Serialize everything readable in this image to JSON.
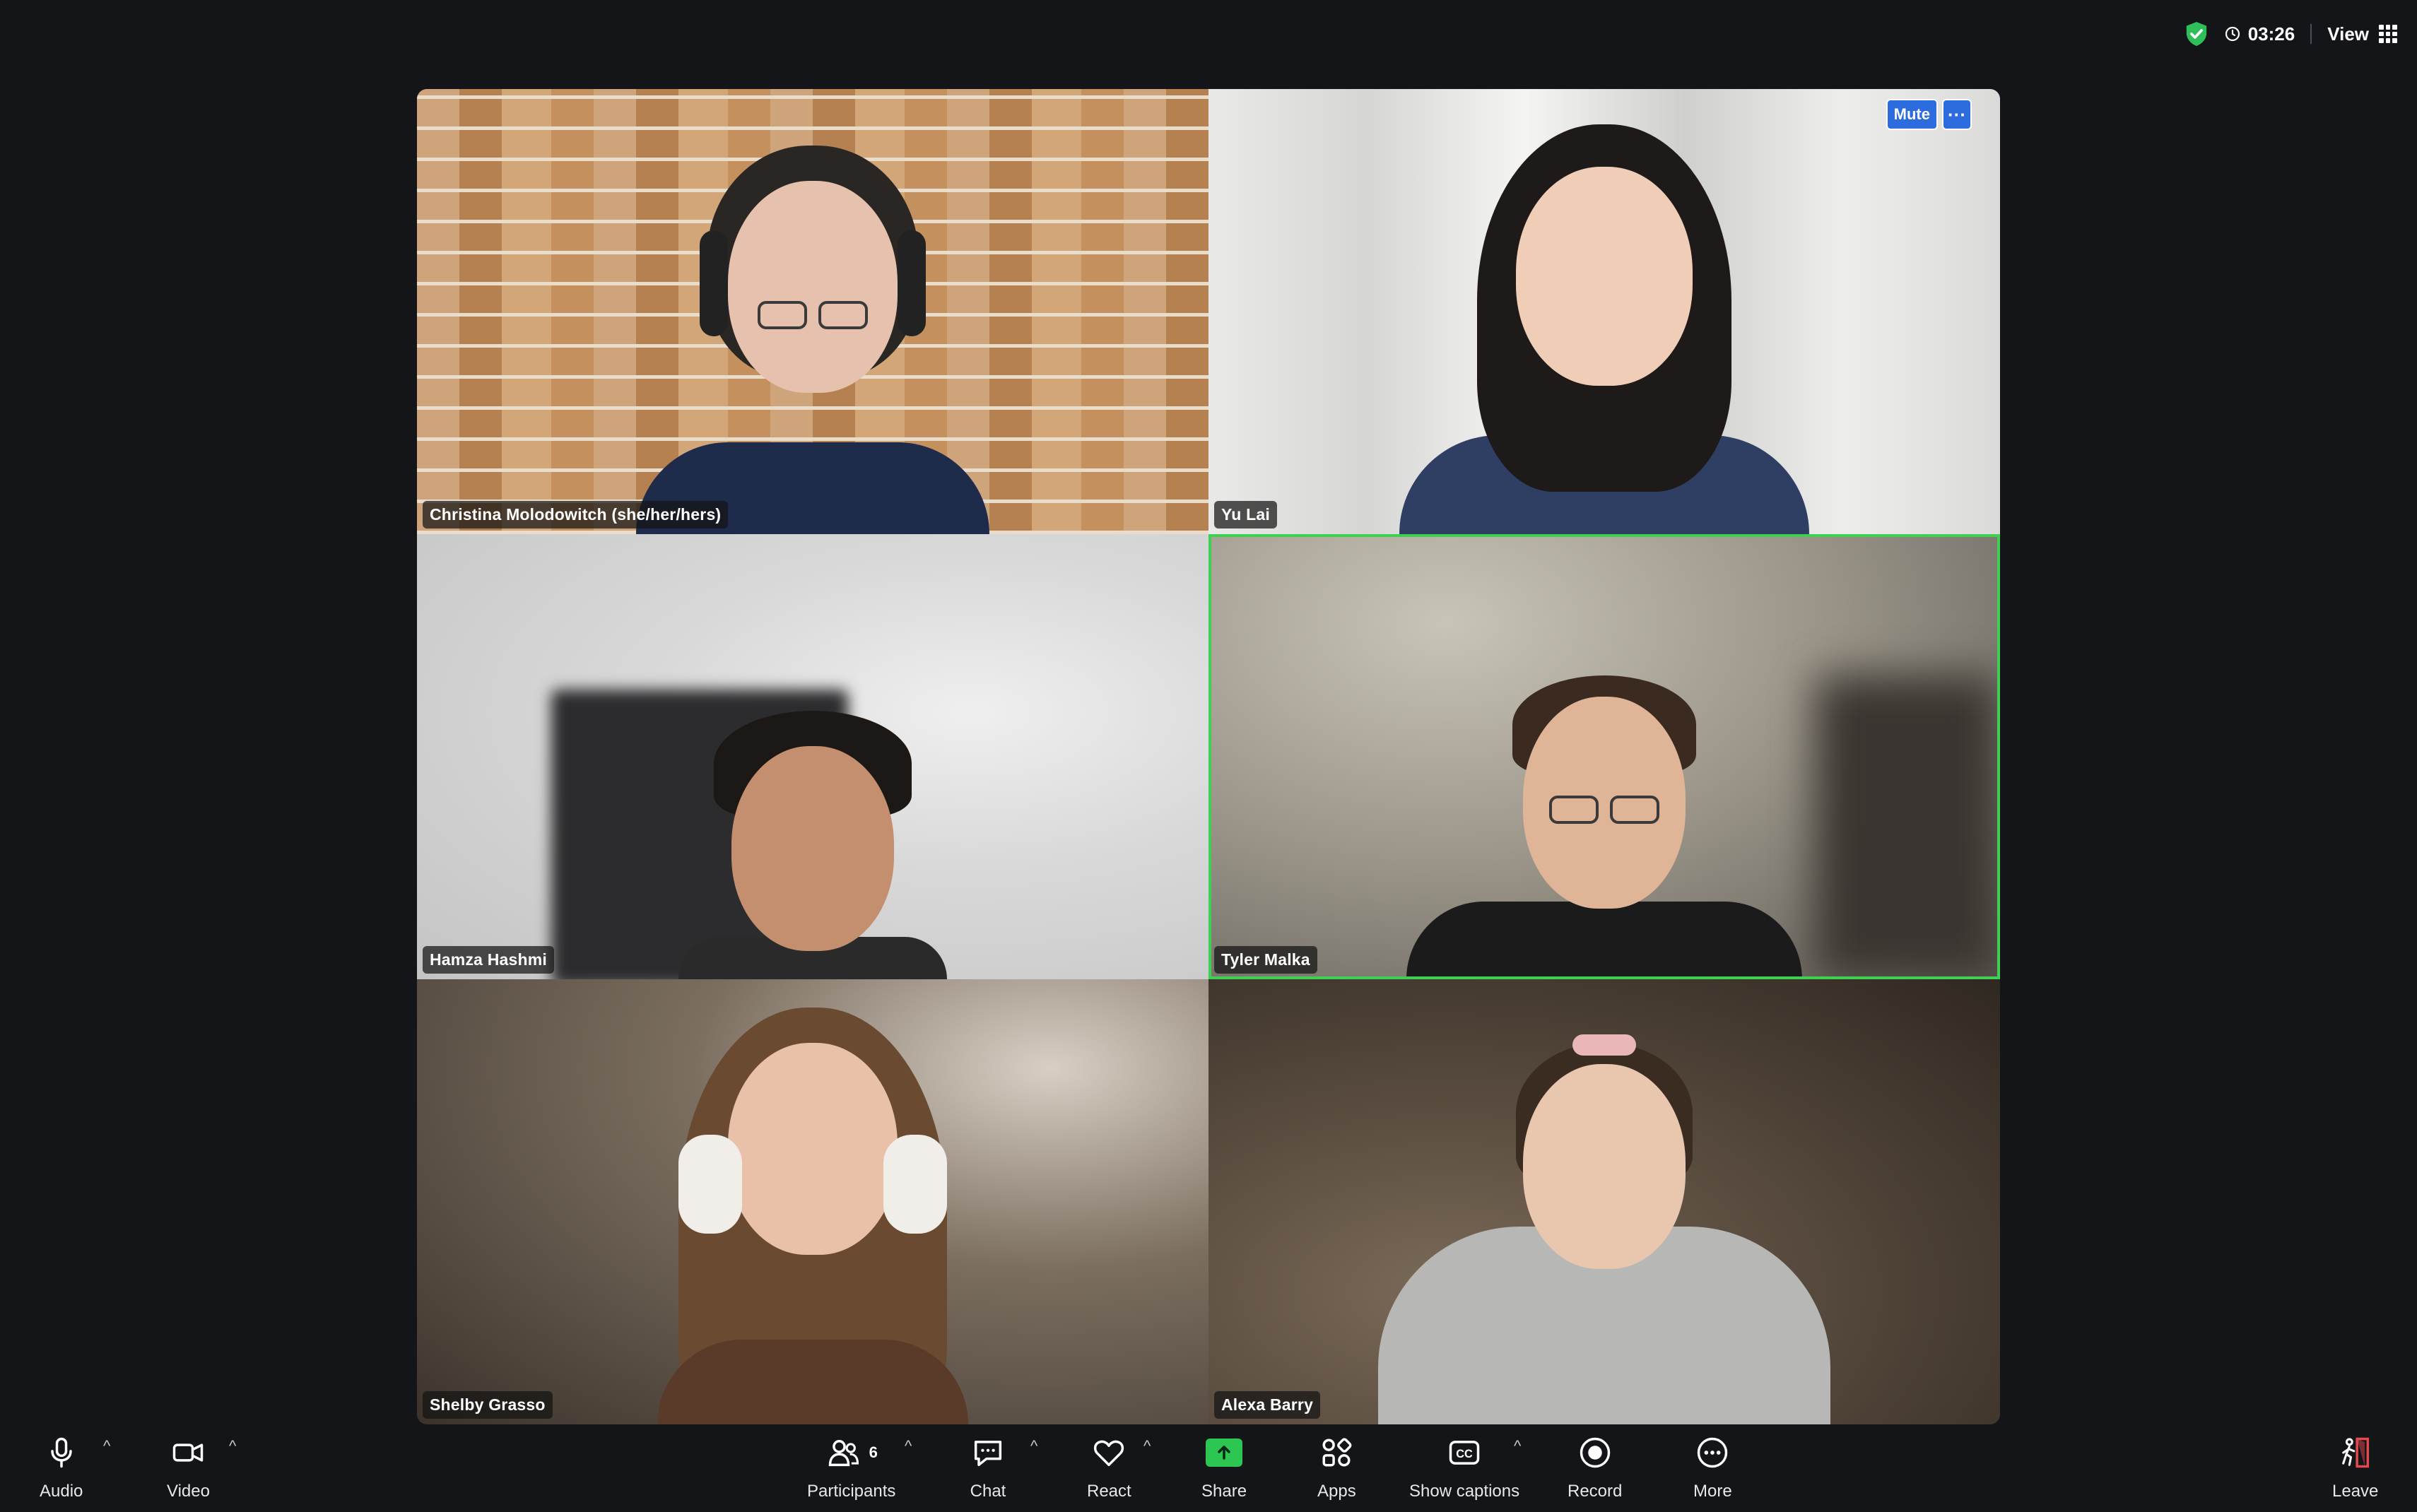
{
  "topbar": {
    "timer": "03:26",
    "view_label": "View"
  },
  "tiles": [
    {
      "name": "Christina Molodowitch (she/her/hers)"
    },
    {
      "name": "Yu Lai",
      "mute_label": "Mute",
      "more_label": "···"
    },
    {
      "name": "Hamza Hashmi"
    },
    {
      "name": "Tyler Malka",
      "active_speaker": true
    },
    {
      "name": "Shelby Grasso"
    },
    {
      "name": "Alexa Barry"
    }
  ],
  "toolbar": {
    "audio": "Audio",
    "video": "Video",
    "participants": "Participants",
    "participants_count": "6",
    "chat": "Chat",
    "react": "React",
    "share": "Share",
    "apps": "Apps",
    "captions": "Show captions",
    "record": "Record",
    "more": "More",
    "leave": "Leave"
  },
  "colors": {
    "background": "#131519",
    "active_speaker_border": "#3fcf52",
    "accent_blue": "#2d6cdf",
    "share_green": "#2dc653",
    "leave_red": "#e5484d"
  }
}
